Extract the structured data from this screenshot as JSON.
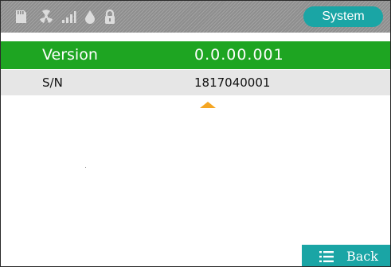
{
  "status_bar": {
    "icons": [
      "sd-card-icon",
      "radiation-icon",
      "signal-icon",
      "drop-icon",
      "lock-icon"
    ],
    "mode_button_label": "System"
  },
  "info_rows": [
    {
      "label": "Version",
      "value": "0.0.00.001",
      "selected": true
    },
    {
      "label": "S/N",
      "value": "1817040001",
      "selected": false
    }
  ],
  "footer": {
    "back_label": "Back"
  },
  "colors": {
    "status_bar_bg": "#8e8e8e",
    "accent_teal": "#1aa5a5",
    "selected_row_green": "#1ea522",
    "row_gray": "#e6e6e6",
    "scroll_arrow": "#f5a623"
  }
}
